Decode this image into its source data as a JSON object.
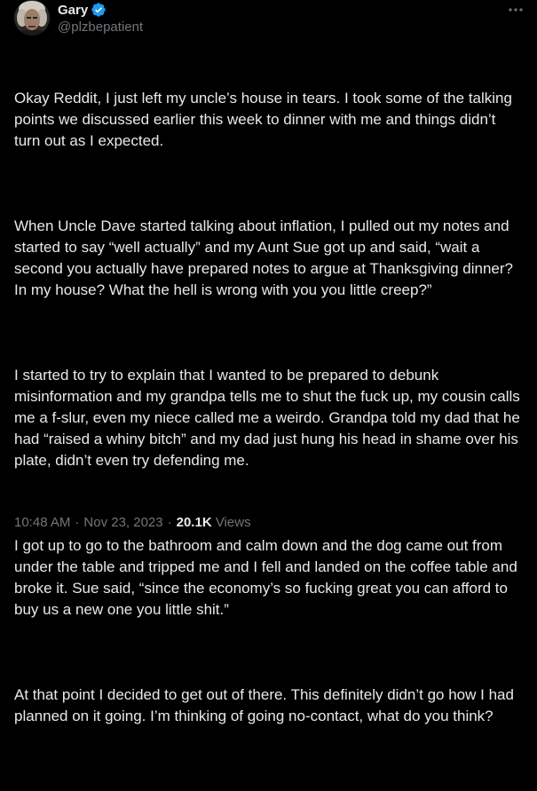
{
  "author": {
    "display_name": "Gary",
    "handle": "@plzbepatient",
    "verified": true
  },
  "icons": {
    "verified": "verified-badge-icon",
    "more": "more-options-icon",
    "avatar": "avatar-photo"
  },
  "colors": {
    "background": "#000000",
    "text": "#e7e9ea",
    "muted": "#71767b",
    "verified": "#1d9bf0"
  },
  "tweet": {
    "paragraphs": [
      "Okay Reddit, I just left my uncle’s house in tears. I took some of the talking points we discussed earlier this week to dinner with me and things didn’t turn out as I expected.",
      "When Uncle Dave started talking about inflation, I pulled out my notes and started to say “well actually” and my Aunt Sue got up and said, “wait a second you actually have prepared notes to argue at Thanksgiving dinner? In my house? What the hell is wrong with you you little creep?”",
      "I started to try to explain that I wanted to be prepared to debunk misinformation and my grandpa tells me to shut the fuck up, my cousin calls me a f-slur, even my niece called me a weirdo. Grandpa told my dad that he had “raised a whiny bitch” and my dad just hung his head in shame over his plate, didn’t even try defending me.",
      "I got up to go to the bathroom and calm down and the dog came out from under the table and tripped me and I fell and landed on the coffee table and broke it. Sue said, “since the economy’s so fucking great you can afford to buy us a new one you little shit.”",
      "At that point I decided to get out of there. This definitely didn’t go how I had planned on it going. I’m thinking of going no-contact, what do you think?"
    ],
    "time": "10:48 AM",
    "separator": "·",
    "date": "Nov 23, 2023",
    "views_count": "20.1K",
    "views_label": "Views"
  }
}
